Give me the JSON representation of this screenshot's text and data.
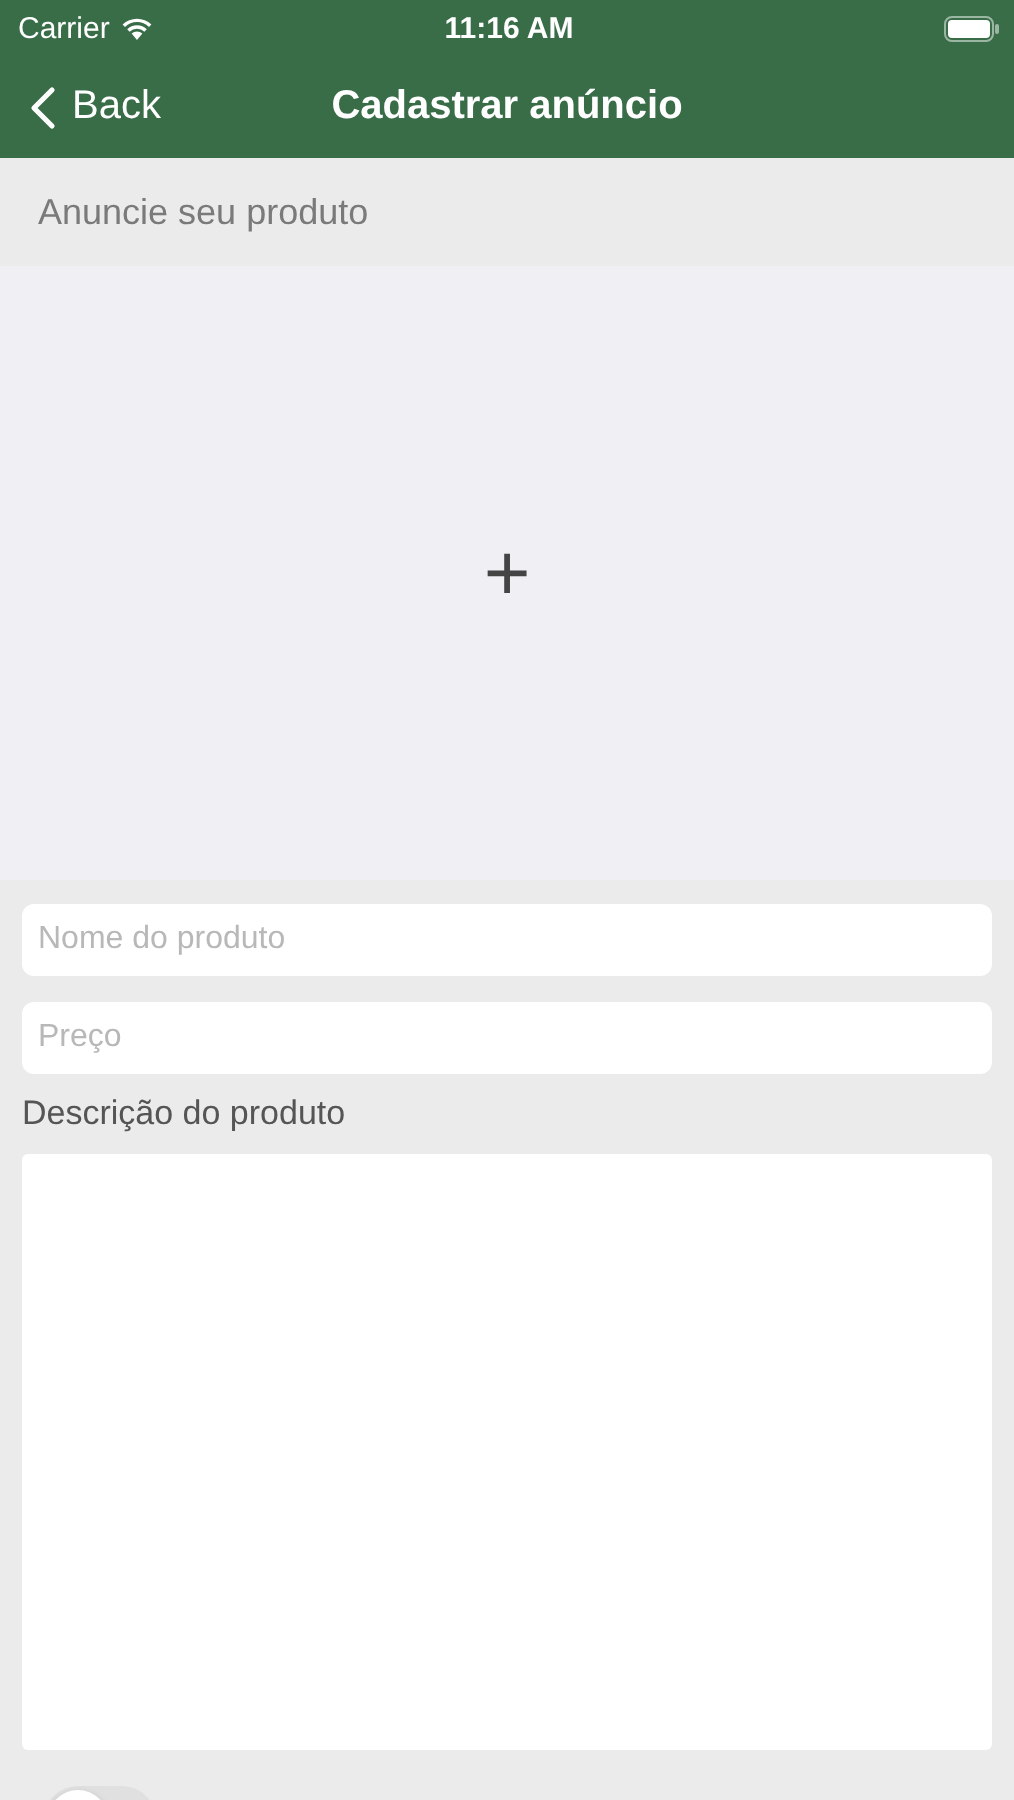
{
  "status_bar": {
    "carrier": "Carrier",
    "time": "11:16 AM"
  },
  "nav": {
    "back": "Back",
    "title": "Cadastrar anúncio"
  },
  "section_header": "Anuncie seu produto",
  "photo_add": {
    "symbol": "+"
  },
  "fields": [
    {
      "placeholder": "Nome do produto"
    },
    {
      "placeholder": "Preço"
    }
  ],
  "description": {
    "label": "Descrição do produto"
  },
  "toggle": {
    "on": false
  }
}
